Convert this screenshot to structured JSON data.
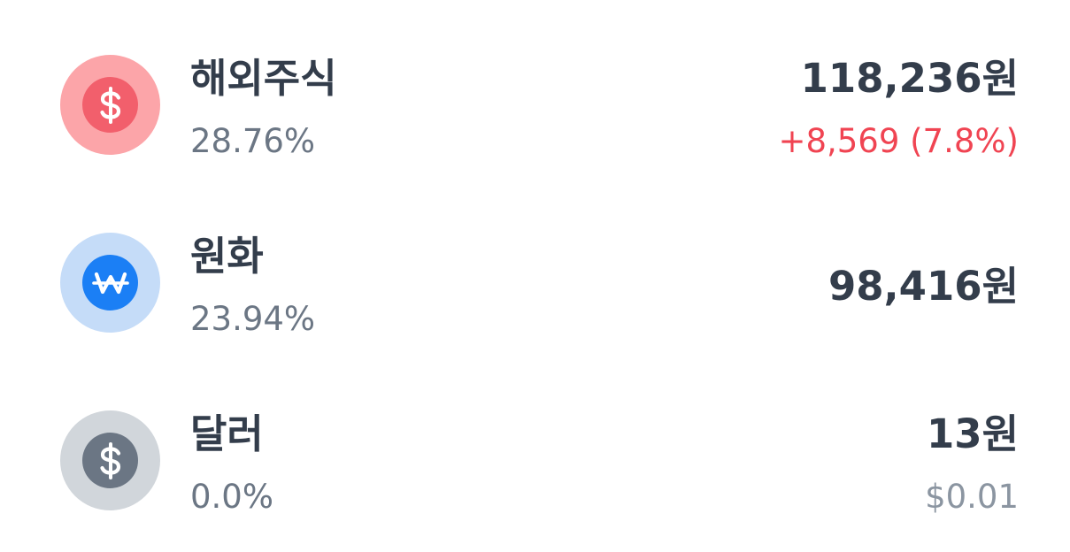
{
  "assets": [
    {
      "name": "해외주식",
      "percent": "28.76%",
      "amount": "118,236원",
      "sub": "+8,569 (7.8%)",
      "icon": "dollar-icon",
      "icon_outer_color": "#fca5a9",
      "icon_inner_color": "#f25f6c",
      "sub_color": "#f04452"
    },
    {
      "name": "원화",
      "percent": "23.94%",
      "amount": "98,416원",
      "icon": "won-icon",
      "icon_outer_color": "#c5dcf8",
      "icon_inner_color": "#1b7ff5"
    },
    {
      "name": "달러",
      "percent": "0.0%",
      "amount": "13원",
      "sub": "$0.01",
      "icon": "dollar-icon",
      "icon_outer_color": "#d1d6db",
      "icon_inner_color": "#6b7684",
      "sub_color": "#8b95a1"
    }
  ]
}
